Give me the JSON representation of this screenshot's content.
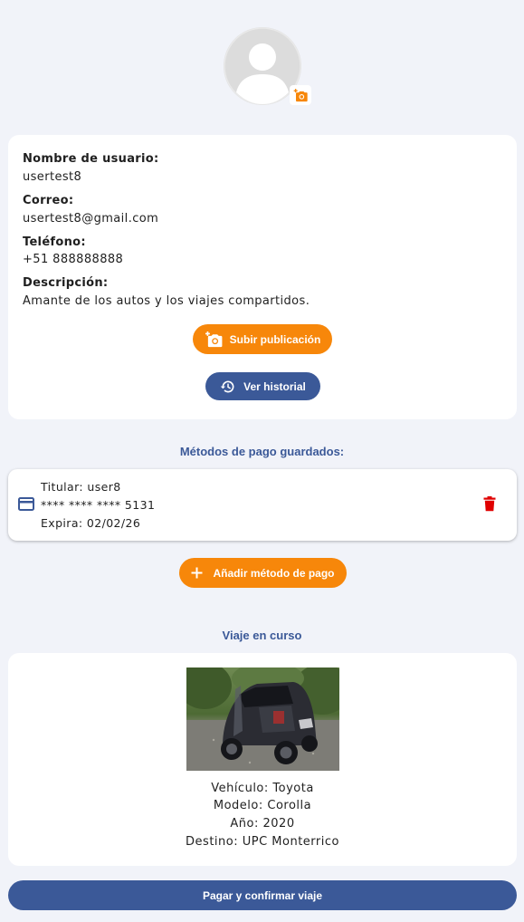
{
  "profile": {
    "username_label": "Nombre de usuario:",
    "username": "usertest8",
    "email_label": "Correo:",
    "email": "usertest8@gmail.com",
    "phone_label": "Teléfono:",
    "phone": "+51 888888888",
    "description_label": "Descripción:",
    "description": "Amante de los autos y los viajes compartidos."
  },
  "actions": {
    "upload_post": "Subir publicación",
    "view_history": "Ver historial"
  },
  "payment": {
    "section_title": "Métodos de pago guardados:",
    "card_holder": "Titular: user8",
    "card_number": "**** **** **** 5131",
    "card_expiry": "Expira: 02/02/26",
    "add_label": "Añadir método de pago"
  },
  "trip": {
    "section_title": "Viaje en curso",
    "vehicle": "Vehículo: Toyota",
    "model": "Modelo: Corolla",
    "year": "Año: 2020",
    "destination": "Destino: UPC Monterrico",
    "pay_button": "Pagar y confirmar viaje"
  },
  "colors": {
    "accent_orange": "#f7870a",
    "accent_blue": "#3b5998",
    "delete_red": "#e00000",
    "background": "#f1f3f9"
  },
  "icons": {
    "avatar": "person-placeholder-icon",
    "avatar_upload": "add-photo-icon",
    "upload_post": "add-photo-icon",
    "view_history": "history-icon",
    "card": "credit-card-icon",
    "delete": "trash-icon",
    "add": "plus-icon"
  }
}
